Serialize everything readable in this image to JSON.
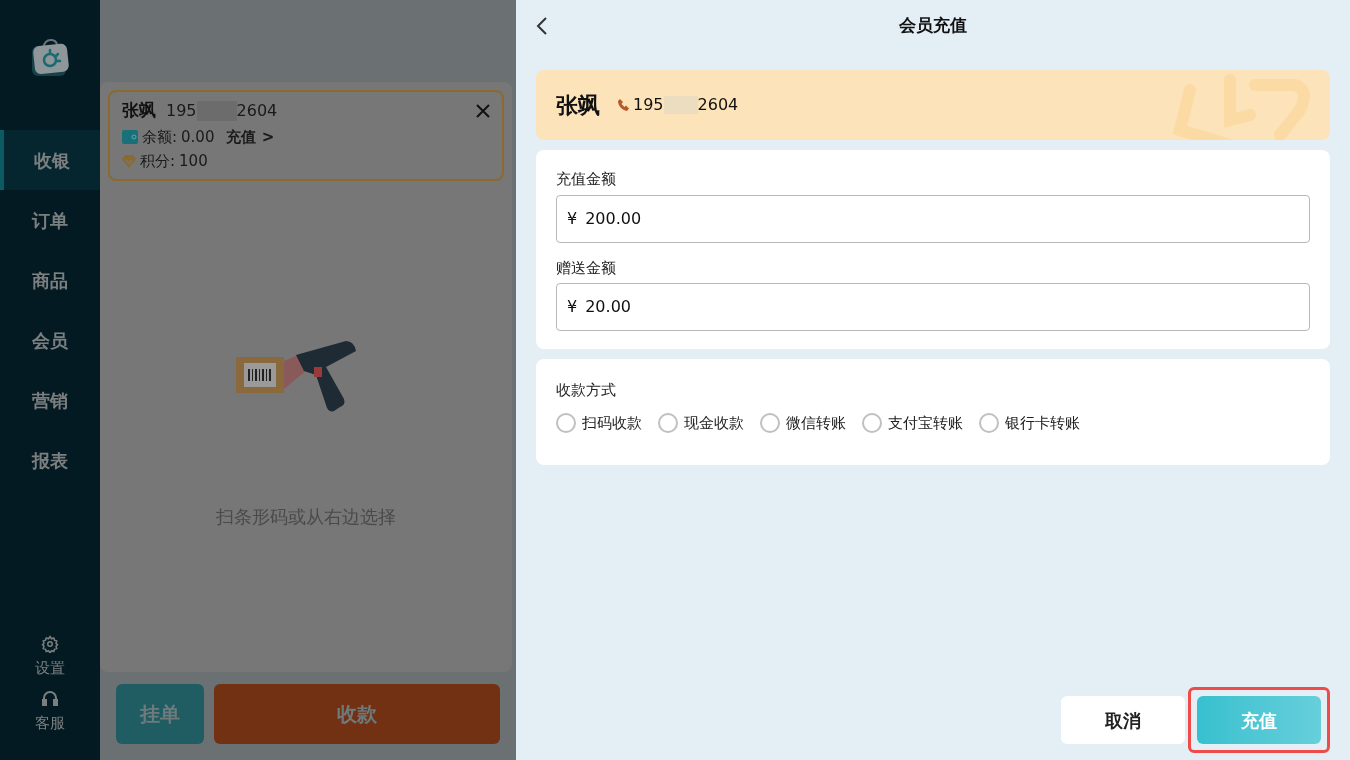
{
  "sidebar": {
    "items": [
      {
        "label": "收银",
        "selected": true
      },
      {
        "label": "订单",
        "selected": false
      },
      {
        "label": "商品",
        "selected": false
      },
      {
        "label": "会员",
        "selected": false
      },
      {
        "label": "营销",
        "selected": false
      },
      {
        "label": "报表",
        "selected": false
      }
    ],
    "bottom_items": [
      {
        "kind": "settings",
        "label": "设置"
      },
      {
        "kind": "support",
        "label": "客服"
      }
    ]
  },
  "cart": {
    "member": {
      "name": "张飒",
      "phone_prefix": "195",
      "phone_suffix": "2604",
      "balance_label": "余额:",
      "balance": "0.00",
      "recharge_link": "充值 >",
      "points_label": "积分:",
      "points": "100"
    },
    "empty_hint": "扫条形码或从右边选择",
    "buttons": [
      {
        "kind": "hold",
        "label": "挂单"
      },
      {
        "kind": "pay",
        "label": "收款"
      }
    ]
  },
  "dialog": {
    "title": "会员充值",
    "member": {
      "name": "张飒",
      "phone_prefix": "195",
      "phone_suffix": "2604"
    },
    "fields": [
      {
        "label": "充值金额",
        "currency": "¥",
        "value": "200.00"
      },
      {
        "label": "赠送金额",
        "currency": "¥",
        "value": "20.00"
      }
    ],
    "payment": {
      "label": "收款方式",
      "options": [
        {
          "label": "扫码收款",
          "selected": false
        },
        {
          "label": "现金收款",
          "selected": false
        },
        {
          "label": "微信转账",
          "selected": false
        },
        {
          "label": "支付宝转账",
          "selected": false
        },
        {
          "label": "银行卡转账",
          "selected": false
        }
      ]
    },
    "buttons": [
      {
        "kind": "cancel",
        "label": "取消",
        "highlighted": false
      },
      {
        "kind": "confirm",
        "label": "充值",
        "highlighted": true
      }
    ]
  }
}
